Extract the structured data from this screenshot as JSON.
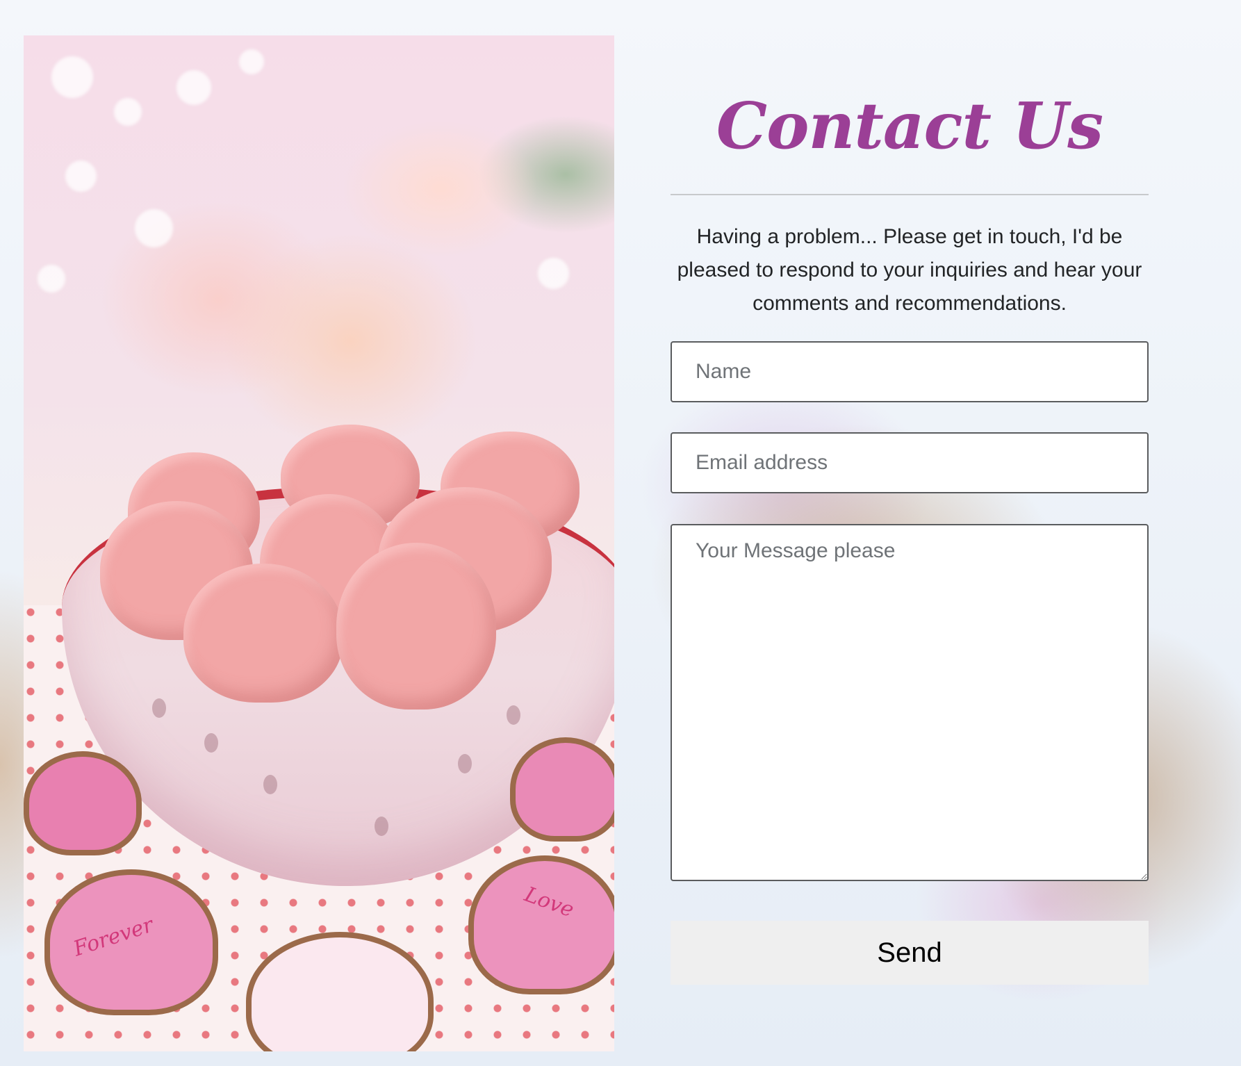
{
  "hero_image": {
    "description_icon": "heart-cookies-photo",
    "cookie_text_1": "Forever",
    "cookie_text_2": "Love"
  },
  "contact": {
    "title": "Contact Us",
    "intro": "Having a problem... Please get in touch, I'd be pleased to respond to your inquiries and hear your comments and recommendations.",
    "name_placeholder": "Name",
    "email_placeholder": "Email address",
    "message_placeholder": "Your Message please",
    "send_label": "Send"
  },
  "colors": {
    "title": "#9b3f96",
    "send_bg": "#efefef",
    "field_border": "#5a5c5e"
  }
}
